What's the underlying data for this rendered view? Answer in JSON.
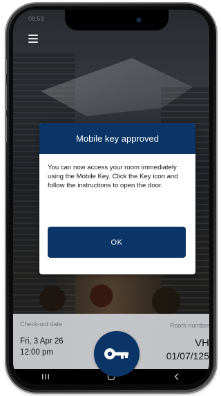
{
  "status_bar": {
    "time": "08:53"
  },
  "dialog": {
    "title": "Mobile key approved",
    "message": "You can now access your room immediately using the Mobile Key. Click the Key icon and follow the instructions to open the door.",
    "ok_label": "OK"
  },
  "stay_info": {
    "checkout_label": "Check-out date",
    "checkout_date": "Fri, 3 Apr 26",
    "checkout_time": "12:00 pm",
    "room_label": "Room number",
    "room_code": "VH",
    "room_number": "01/07/125"
  },
  "icons": {
    "menu": "hamburger-menu-icon",
    "key": "key-icon",
    "nav_recents": "recents-icon",
    "nav_home": "home-icon",
    "nav_back": "back-icon"
  },
  "colors": {
    "brand_navy": "#0b3567",
    "info_bar": "#cfd1d5"
  }
}
